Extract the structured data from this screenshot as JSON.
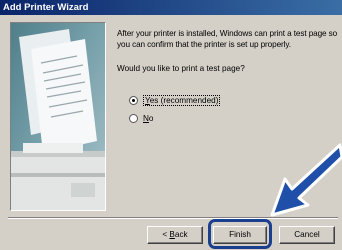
{
  "window": {
    "title": "Add Printer Wizard"
  },
  "content": {
    "description": "After your printer is installed, Windows can print a test page so you can confirm that the printer is set up properly.",
    "question": "Would you like to print a test page?"
  },
  "options": [
    {
      "accel": "Y",
      "rest": "es (recommended)",
      "selected": true
    },
    {
      "accel": "N",
      "rest": "o",
      "selected": false
    }
  ],
  "buttons": {
    "back_prefix": "< ",
    "back_accel": "B",
    "back_rest": "ack",
    "finish": "Finish",
    "cancel": "Cancel"
  },
  "annotation": {
    "highlight_color": "#1b3f8f",
    "arrow_color": "#1f4fa8",
    "target": "finish-button"
  },
  "icons": [
    "printer-illustration",
    "pointer-arrow-icon"
  ]
}
